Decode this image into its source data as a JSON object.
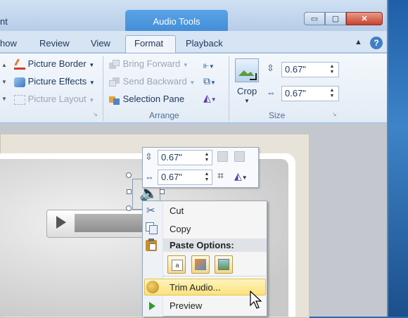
{
  "window": {
    "app_title_fragment": "nt",
    "context_group_title": "Audio Tools",
    "controls": {
      "minimize": "▭",
      "maximize": "▢",
      "close": "✕"
    }
  },
  "tabs": [
    {
      "label": "how"
    },
    {
      "label": "Review"
    },
    {
      "label": "View"
    },
    {
      "label": "Format",
      "active": true
    },
    {
      "label": "Playback"
    }
  ],
  "ribbon": {
    "picture_styles": {
      "border": "Picture Border",
      "effects": "Picture Effects",
      "layout": "Picture Layout"
    },
    "arrange": {
      "label": "Arrange",
      "bring_forward": "Bring Forward",
      "send_backward": "Send Backward",
      "selection_pane": "Selection Pane"
    },
    "size": {
      "label": "Size",
      "crop": "Crop",
      "height": "0.67\"",
      "width": "0.67\""
    }
  },
  "mini_toolbar": {
    "height": "0.67\"",
    "width": "0.67\""
  },
  "context_menu": {
    "cut": "Cut",
    "copy": "Copy",
    "paste_options": "Paste Options:",
    "trim_audio": "Trim Audio...",
    "preview": "Preview"
  },
  "colors": {
    "accent_blue": "#3f8ad6",
    "highlight_yellow": "#fbe27c",
    "close_red": "#c9422d"
  }
}
